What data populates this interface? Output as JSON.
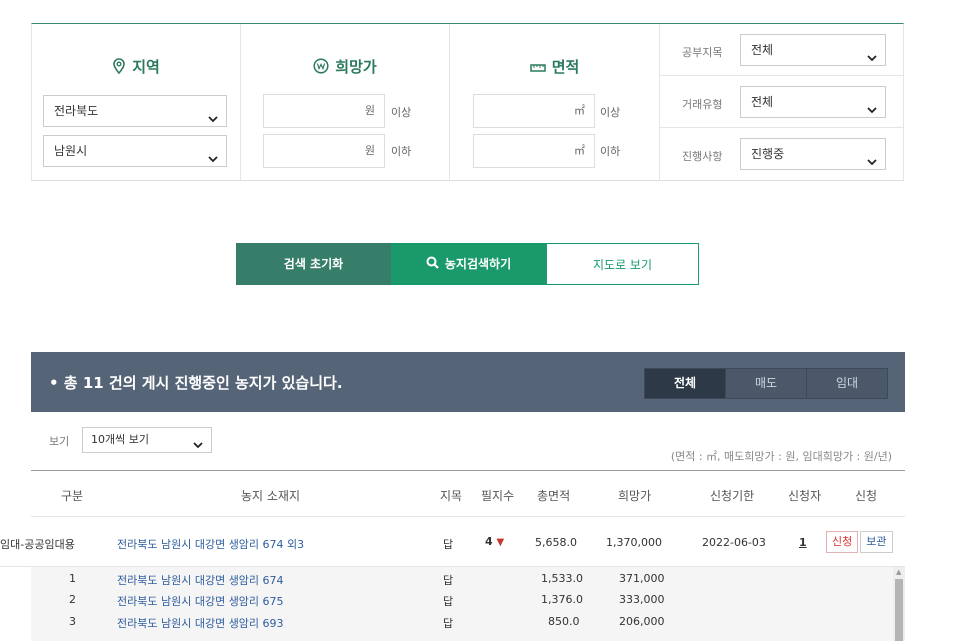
{
  "search": {
    "region": {
      "title": "지역",
      "province": "전라북도",
      "city": "남원시"
    },
    "price": {
      "title": "희망가",
      "unit": "원",
      "min_suffix": "이상",
      "max_suffix": "이하"
    },
    "area": {
      "title": "면적",
      "unit": "㎡",
      "min_suffix": "이상",
      "max_suffix": "이하"
    },
    "filters": [
      {
        "label": "공부지목",
        "value": "전체"
      },
      {
        "label": "거래유형",
        "value": "전체"
      },
      {
        "label": "진행사항",
        "value": "진행중"
      }
    ]
  },
  "buttons": {
    "reset": "검색 초기화",
    "search": "농지검색하기",
    "map": "지도로 보기"
  },
  "results": {
    "summary": "• 총 11 건의 게시 진행중인 농지가 있습니다.",
    "tabs": [
      "전체",
      "매도",
      "임대"
    ],
    "active_tab": "전체",
    "view_label": "보기",
    "view_value": "10개씩 보기",
    "unit_note": "(면적 : ㎡, 매도희망가 : 원, 임대희망가 : 원/년)"
  },
  "table": {
    "headers": [
      "구분",
      "농지 소재지",
      "지목",
      "필지수",
      "총면적",
      "희망가",
      "신청기한",
      "신청자",
      "신청"
    ],
    "main_row": {
      "type": "임대-공공임대용",
      "location": "전라북도 남원시 대강면 생암리 674 외3",
      "category": "답",
      "parcels": "4",
      "area": "5,658.0",
      "price": "1,370,000",
      "deadline": "2022-06-03",
      "applicants": "1",
      "apply_label": "신청",
      "save_label": "보관"
    },
    "sub_rows": [
      {
        "no": "1",
        "location": "전라북도 남원시 대강면 생암리 674",
        "category": "답",
        "area": "1,533.0",
        "price": "371,000"
      },
      {
        "no": "2",
        "location": "전라북도 남원시 대강면 생암리 675",
        "category": "답",
        "area": "1,376.0",
        "price": "333,000"
      },
      {
        "no": "3",
        "location": "전라북도 남원시 대강면 생암리 693",
        "category": "답",
        "area": "850.0",
        "price": "206,000"
      }
    ]
  },
  "colors": {
    "accent": "#1a9a6a",
    "dark_green": "#367d6a",
    "bar": "#566477"
  }
}
